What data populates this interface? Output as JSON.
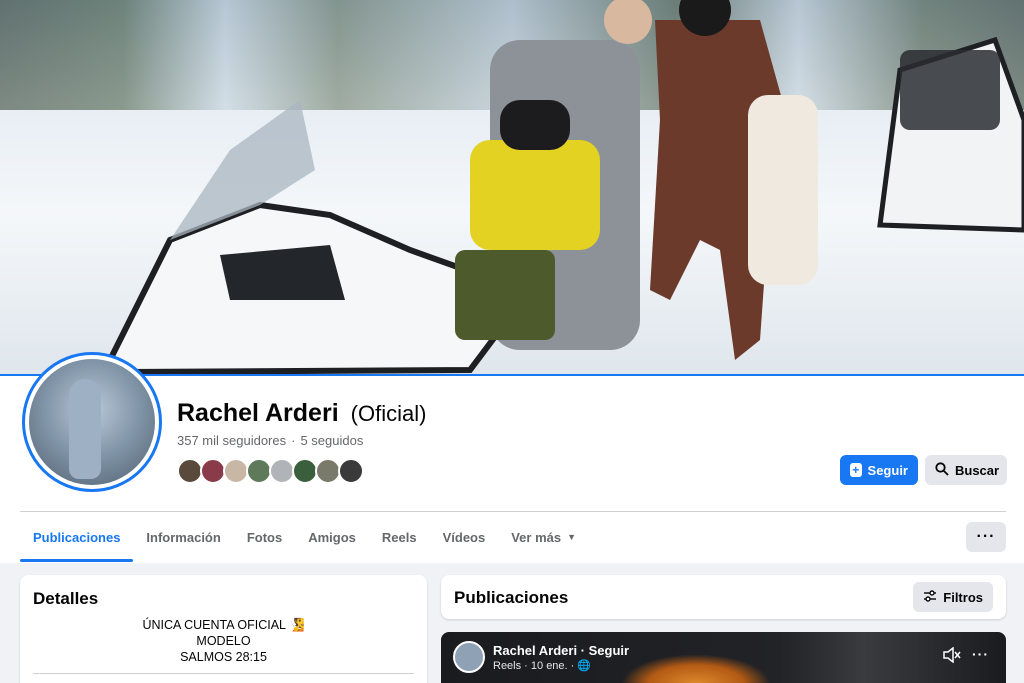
{
  "profile": {
    "name": "Rachel Arderi",
    "tag": "(Oficial)",
    "followers": "357 mil seguidores",
    "dot": "·",
    "following": "5 seguidos"
  },
  "actions": {
    "follow_label": "Seguir",
    "search_label": "Buscar",
    "more_label": "···"
  },
  "tabs": [
    {
      "label": "Publicaciones"
    },
    {
      "label": "Información"
    },
    {
      "label": "Fotos"
    },
    {
      "label": "Amigos"
    },
    {
      "label": "Reels"
    },
    {
      "label": "Vídeos"
    },
    {
      "label": "Ver más"
    }
  ],
  "details": {
    "title": "Detalles",
    "bio_line1": "ÚNICA CUENTA OFICIAL 🧏",
    "bio_line2": "MODELO",
    "bio_line3": "SALMOS 28:15"
  },
  "posts": {
    "title": "Publicaciones",
    "filter_label": "Filtros"
  },
  "reel": {
    "author": "Rachel Arderi · Seguir",
    "meta": "Reels · 10 ene. · 🌐"
  },
  "colors": {
    "accent": "#1877f2",
    "friends": [
      "#5a4a3c",
      "#8a3b4a",
      "#c9b7a5",
      "#5e7a5a",
      "#b0b3b8",
      "#3b5f3c",
      "#7a7a6a",
      "#3a3a3a"
    ]
  },
  "icons": {
    "follow": "plus-square-icon",
    "search": "search-icon",
    "filter": "sliders-icon",
    "caret": "caret-down-icon",
    "mute": "muted-speaker-icon",
    "more": "more-dots-icon"
  }
}
